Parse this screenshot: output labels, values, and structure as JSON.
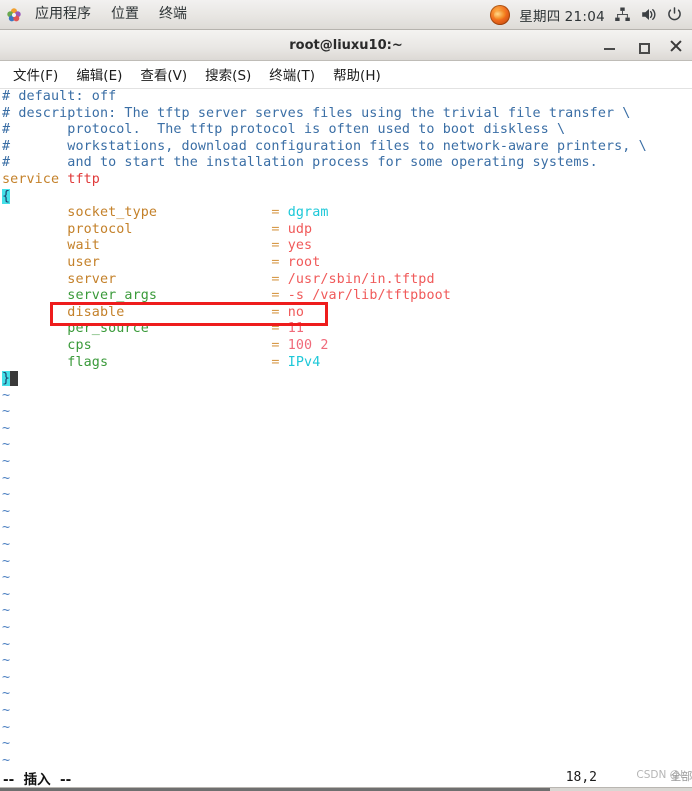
{
  "panel": {
    "apps_icon": "flower-icon",
    "menus": [
      "应用程序",
      "位置",
      "终端"
    ],
    "firefox_icon": "firefox-icon",
    "weekday": "星期四",
    "time": "21:04",
    "tray": [
      "network-icon",
      "volume-icon",
      "power-icon"
    ]
  },
  "window": {
    "title": "root@liuxu10:~",
    "minimize_label": "minimize",
    "maximize_label": "maximize",
    "close_label": "close"
  },
  "menubar": [
    "文件(F)",
    "编辑(E)",
    "查看(V)",
    "搜索(S)",
    "终端(T)",
    "帮助(H)"
  ],
  "editor": {
    "comments": [
      "# default: off",
      "# description: The tftp server serves files using the trivial file transfer \\",
      "#       protocol.  The tftp protocol is often used to boot diskless \\",
      "#       workstations, download configuration files to network-aware printers, \\",
      "#       and to start the installation process for some operating systems."
    ],
    "service_kw": "service",
    "service_name": "tftp",
    "open_brace": "{",
    "close_brace": "}",
    "entries": [
      {
        "key": "socket_type",
        "eq": "=",
        "value": "dgram",
        "key_color": "orange",
        "value_color": "cyan"
      },
      {
        "key": "protocol",
        "eq": "=",
        "value": "udp",
        "key_color": "orange",
        "value_color": "red"
      },
      {
        "key": "wait",
        "eq": "=",
        "value": "yes",
        "key_color": "orange",
        "value_color": "red"
      },
      {
        "key": "user",
        "eq": "=",
        "value": "root",
        "key_color": "orange",
        "value_color": "red"
      },
      {
        "key": "server",
        "eq": "=",
        "value": "/usr/sbin/in.tftpd",
        "key_color": "orange",
        "value_color": "red"
      },
      {
        "key": "server_args",
        "eq": "=",
        "value": "-s /var/lib/tftpboot",
        "key_color": "green",
        "value_color": "red"
      },
      {
        "key": "disable",
        "eq": "=",
        "value": "no",
        "key_color": "purple",
        "value_color": "red"
      },
      {
        "key": "per_source",
        "eq": "=",
        "value": "11",
        "key_color": "green",
        "value_color": "pink"
      },
      {
        "key": "cps",
        "eq": "=",
        "value": "100 2",
        "key_color": "green",
        "value_color": "pink"
      },
      {
        "key": "flags",
        "eq": "=",
        "value": "IPv4",
        "key_color": "green",
        "value_color": "cyan"
      }
    ],
    "empty_marker": "~",
    "empty_line_count": 24,
    "annotation": {
      "shape": "rectangle",
      "color": "#ee1c1c",
      "targets": "disable = no"
    }
  },
  "status": {
    "mode": "--  插入  --",
    "position": "18,2",
    "watermark": "CSDN @L",
    "watermark_overlay": "全部"
  }
}
